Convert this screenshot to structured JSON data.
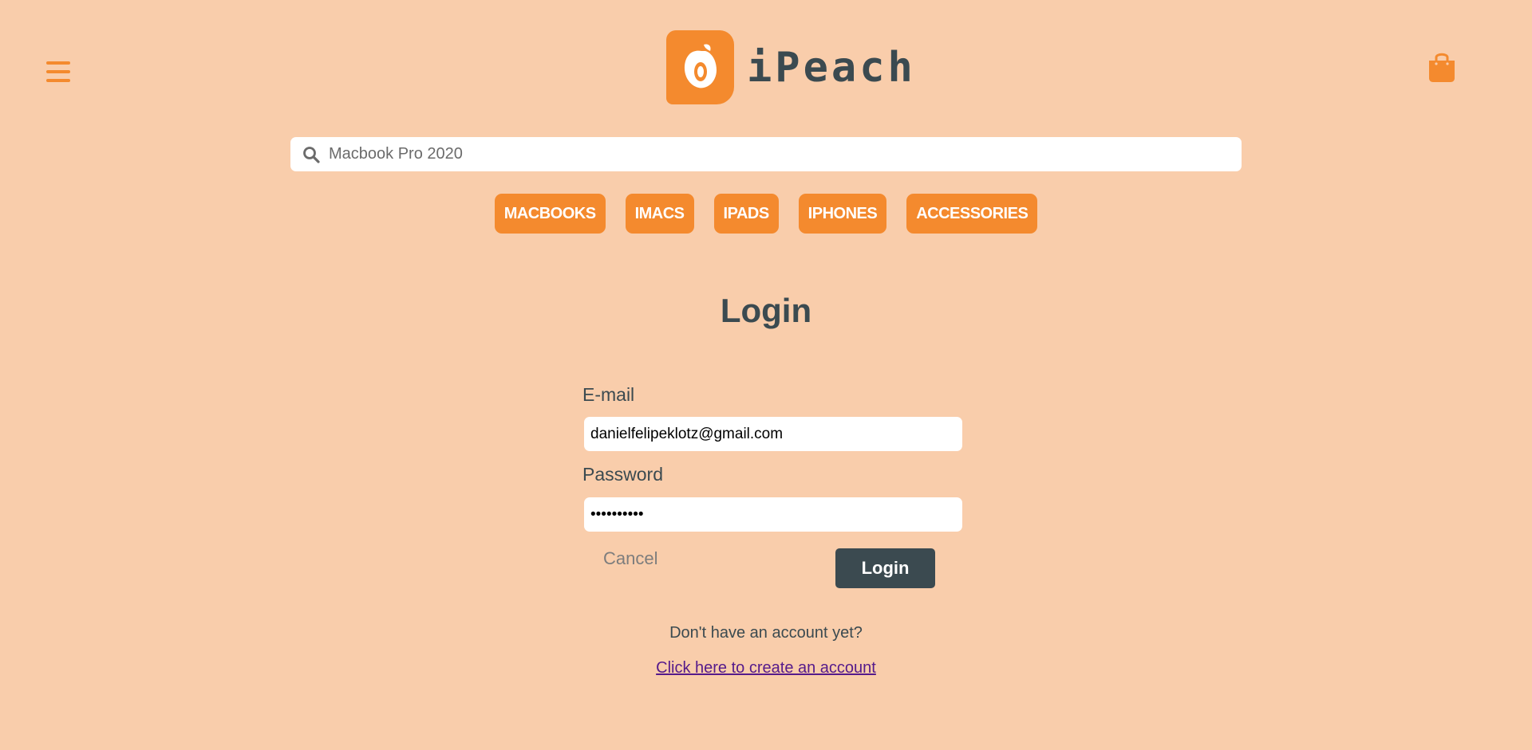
{
  "header": {
    "brand": "iPeach",
    "logo_icon": "peach-icon",
    "menu_icon": "hamburger-menu-icon",
    "cart_icon": "shopping-bag-icon"
  },
  "search": {
    "icon": "search-icon",
    "placeholder": "Macbook Pro 2020",
    "value": ""
  },
  "categories": [
    {
      "label": "MACBOOKS"
    },
    {
      "label": "IMACS"
    },
    {
      "label": "IPADS"
    },
    {
      "label": "IPHONES"
    },
    {
      "label": "ACCESSORIES"
    }
  ],
  "login": {
    "title": "Login",
    "email_label": "E-mail",
    "email_value": "danielfelipeklotz@gmail.com",
    "password_label": "Password",
    "password_value": "••••••••••",
    "cancel_label": "Cancel",
    "submit_label": "Login",
    "no_account_text": "Don't have an account yet?",
    "create_account_link": "Click here to create an account"
  },
  "colors": {
    "background": "#f9cdab",
    "accent": "#f48a2e",
    "dark": "#3b4a50",
    "link": "#551a8b"
  }
}
